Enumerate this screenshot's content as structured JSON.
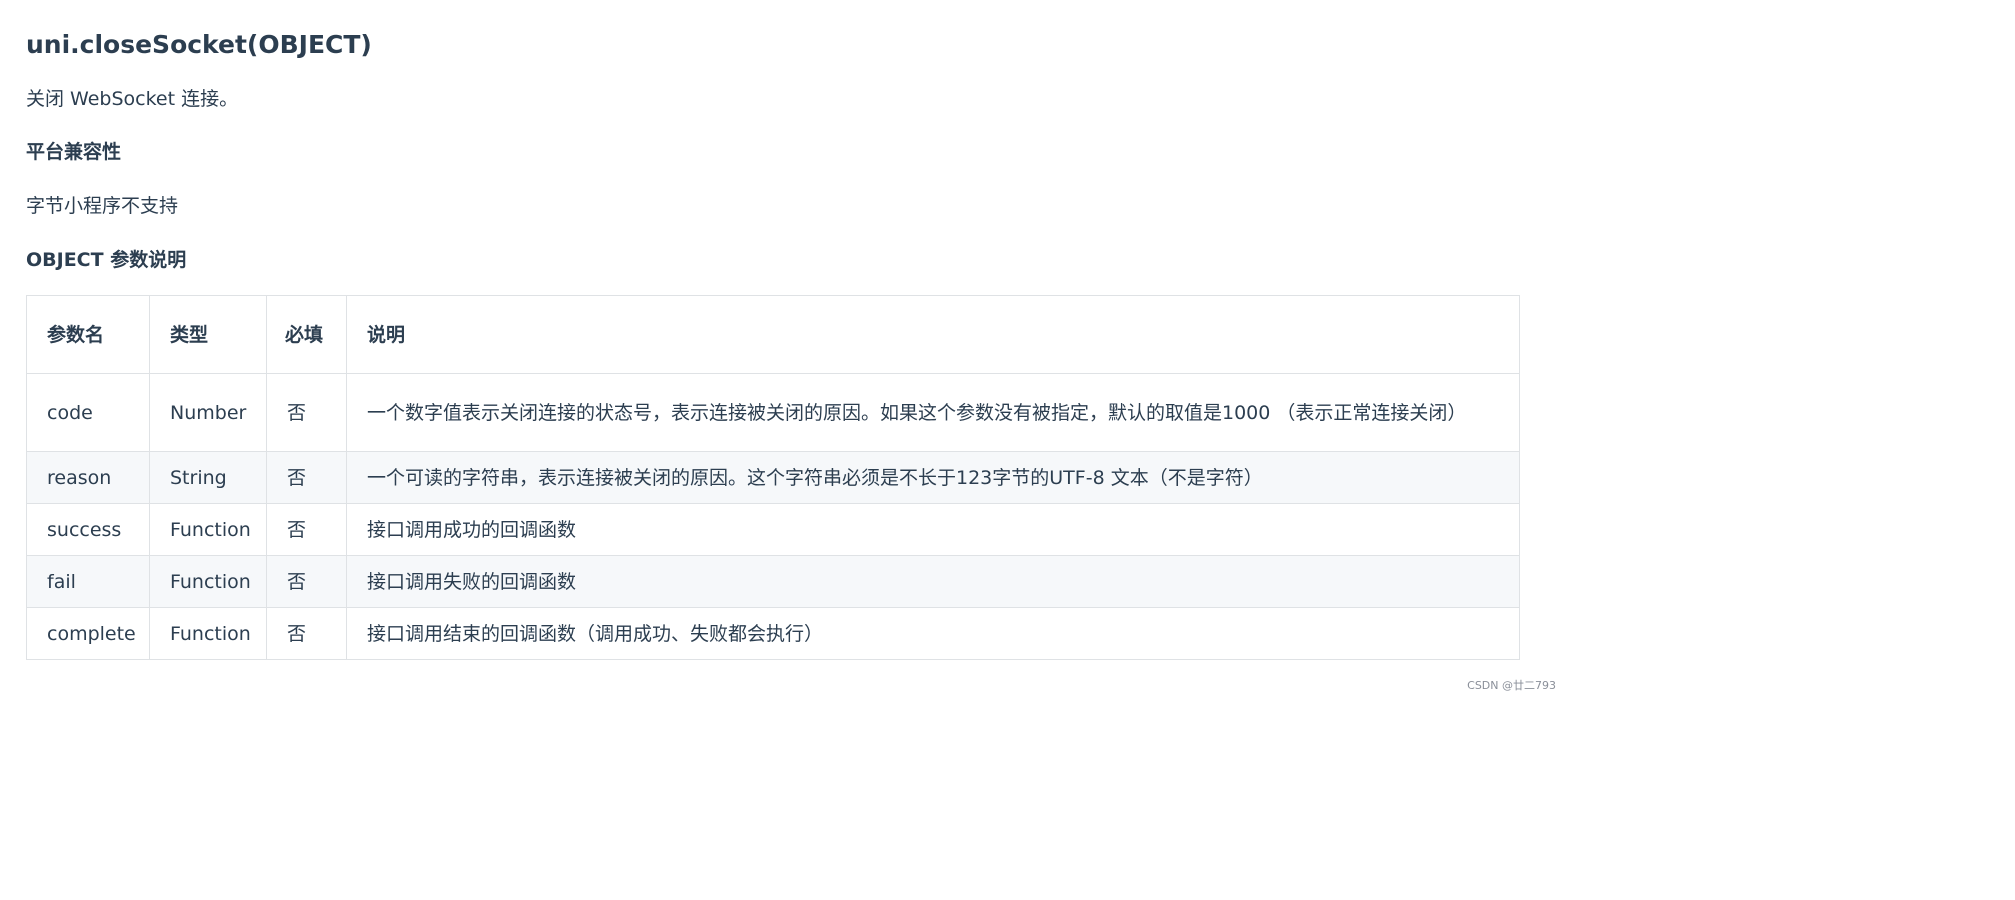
{
  "doc": {
    "title": "uni.closeSocket(OBJECT)",
    "description": "关闭 WebSocket 连接。",
    "compat_heading": "平台兼容性",
    "compat_text": "字节小程序不支持",
    "params_heading": "OBJECT 参数说明"
  },
  "table": {
    "headers": {
      "name": "参数名",
      "type": "类型",
      "required": "必填",
      "desc": "说明"
    },
    "rows": [
      {
        "name": "code",
        "type": "Number",
        "required": "否",
        "desc": "一个数字值表示关闭连接的状态号，表示连接被关闭的原因。如果这个参数没有被指定，默认的取值是1000 （表示正常连接关闭）"
      },
      {
        "name": "reason",
        "type": "String",
        "required": "否",
        "desc": "一个可读的字符串，表示连接被关闭的原因。这个字符串必须是不长于123字节的UTF-8 文本（不是字符）"
      },
      {
        "name": "success",
        "type": "Function",
        "required": "否",
        "desc": "接口调用成功的回调函数"
      },
      {
        "name": "fail",
        "type": "Function",
        "required": "否",
        "desc": "接口调用失败的回调函数"
      },
      {
        "name": "complete",
        "type": "Function",
        "required": "否",
        "desc": "接口调用结束的回调函数（调用成功、失败都会执行）"
      }
    ]
  },
  "watermark": "CSDN @廿二793"
}
